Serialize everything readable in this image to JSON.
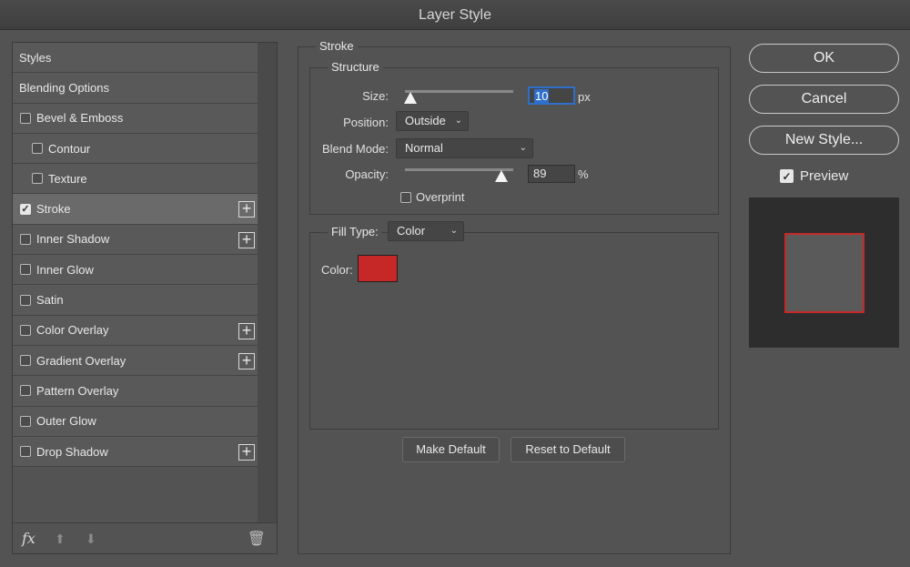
{
  "window": {
    "title": "Layer Style"
  },
  "sidebar": {
    "items": [
      {
        "label": "Styles",
        "type": "header",
        "checkbox": false,
        "checked": false,
        "plus": false
      },
      {
        "label": "Blending Options",
        "type": "header",
        "checkbox": false,
        "checked": false,
        "plus": false
      },
      {
        "label": "Bevel & Emboss",
        "type": "item",
        "checkbox": true,
        "checked": false,
        "plus": false
      },
      {
        "label": "Contour",
        "type": "sub",
        "checkbox": true,
        "checked": false,
        "plus": false
      },
      {
        "label": "Texture",
        "type": "sub",
        "checkbox": true,
        "checked": false,
        "plus": false
      },
      {
        "label": "Stroke",
        "type": "item",
        "checkbox": true,
        "checked": true,
        "plus": true,
        "selected": true
      },
      {
        "label": "Inner Shadow",
        "type": "item",
        "checkbox": true,
        "checked": false,
        "plus": true
      },
      {
        "label": "Inner Glow",
        "type": "item",
        "checkbox": true,
        "checked": false,
        "plus": false
      },
      {
        "label": "Satin",
        "type": "item",
        "checkbox": true,
        "checked": false,
        "plus": false
      },
      {
        "label": "Color Overlay",
        "type": "item",
        "checkbox": true,
        "checked": false,
        "plus": true
      },
      {
        "label": "Gradient Overlay",
        "type": "item",
        "checkbox": true,
        "checked": false,
        "plus": true
      },
      {
        "label": "Pattern Overlay",
        "type": "item",
        "checkbox": true,
        "checked": false,
        "plus": false
      },
      {
        "label": "Outer Glow",
        "type": "item",
        "checkbox": true,
        "checked": false,
        "plus": false
      },
      {
        "label": "Drop Shadow",
        "type": "item",
        "checkbox": true,
        "checked": false,
        "plus": true
      }
    ],
    "footer": {
      "fx_label": "fx",
      "icons": [
        "fx-menu-icon",
        "move-up-icon",
        "move-down-icon",
        "trash-icon"
      ]
    }
  },
  "stroke": {
    "title": "Stroke",
    "structure": {
      "title": "Structure",
      "size_label": "Size:",
      "size_value": "10",
      "size_unit": "px",
      "size_fraction": 0.05,
      "position_label": "Position:",
      "position_value": "Outside",
      "blend_label": "Blend Mode:",
      "blend_value": "Normal",
      "opacity_label": "Opacity:",
      "opacity_value": "89",
      "opacity_unit": "%",
      "overprint_label": "Overprint"
    },
    "fill": {
      "label": "Fill Type:",
      "value": "Color",
      "color_label": "Color:",
      "color": "#c62828"
    },
    "make_default": "Make Default",
    "reset_default": "Reset to Default"
  },
  "actions": {
    "ok": "OK",
    "cancel": "Cancel",
    "new_style": "New Style...",
    "preview_label": "Preview",
    "preview_checked": true
  },
  "colors": {
    "accent": "#2e6fc9",
    "stroke_color": "#c62828"
  }
}
